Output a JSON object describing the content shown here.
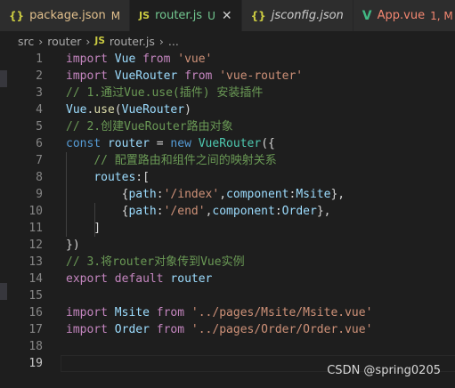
{
  "tabs": [
    {
      "icon": "{}",
      "title": "package.json",
      "badge": "M",
      "active": false
    },
    {
      "icon": "JS",
      "title": "router.js",
      "badge": "U",
      "active": true
    },
    {
      "icon": "{}",
      "title": "jsconfig.json",
      "badge": "",
      "active": false
    },
    {
      "icon": "V",
      "title": "App.vue",
      "badge": "1, M",
      "active": false
    }
  ],
  "breadcrumb": {
    "parts": [
      "src",
      "router"
    ],
    "file_icon": "JS",
    "file": "router.js",
    "ellipsis": "..."
  },
  "code_lines": [
    {
      "n": "1",
      "tokens": [
        [
          "kp",
          "import"
        ],
        [
          "p",
          " "
        ],
        [
          "v",
          "Vue"
        ],
        [
          "p",
          " "
        ],
        [
          "kp",
          "from"
        ],
        [
          "p",
          " "
        ],
        [
          "s",
          "'vue'"
        ]
      ]
    },
    {
      "n": "2",
      "tokens": [
        [
          "kp",
          "import"
        ],
        [
          "p",
          " "
        ],
        [
          "v",
          "VueRouter"
        ],
        [
          "p",
          " "
        ],
        [
          "kp",
          "from"
        ],
        [
          "p",
          " "
        ],
        [
          "s",
          "'vue-router'"
        ]
      ]
    },
    {
      "n": "3",
      "tokens": [
        [
          "c",
          "// 1.通过Vue.use(插件) 安装插件"
        ]
      ]
    },
    {
      "n": "4",
      "tokens": [
        [
          "v",
          "Vue"
        ],
        [
          "p",
          "."
        ],
        [
          "fn",
          "use"
        ],
        [
          "p",
          "("
        ],
        [
          "v",
          "VueRouter"
        ],
        [
          "p",
          ")"
        ]
      ]
    },
    {
      "n": "5",
      "tokens": [
        [
          "c",
          "// 2.创建VueRouter路由对象"
        ]
      ]
    },
    {
      "n": "6",
      "tokens": [
        [
          "k",
          "const"
        ],
        [
          "p",
          " "
        ],
        [
          "v",
          "router"
        ],
        [
          "p",
          " = "
        ],
        [
          "k",
          "new"
        ],
        [
          "p",
          " "
        ],
        [
          "cls",
          "VueRouter"
        ],
        [
          "p",
          "({"
        ]
      ]
    },
    {
      "n": "7",
      "tokens": [
        [
          "p",
          "    "
        ],
        [
          "c",
          "// 配置路由和组件之间的映射关系"
        ]
      ]
    },
    {
      "n": "8",
      "tokens": [
        [
          "p",
          "    "
        ],
        [
          "v",
          "routes"
        ],
        [
          "p",
          ":["
        ]
      ]
    },
    {
      "n": "9",
      "tokens": [
        [
          "p",
          "        {"
        ],
        [
          "v",
          "path"
        ],
        [
          "p",
          ":"
        ],
        [
          "s",
          "'/index'"
        ],
        [
          "p",
          ","
        ],
        [
          "v",
          "component"
        ],
        [
          "p",
          ":"
        ],
        [
          "v",
          "Msite"
        ],
        [
          "p",
          "},"
        ]
      ]
    },
    {
      "n": "10",
      "tokens": [
        [
          "p",
          "        {"
        ],
        [
          "v",
          "path"
        ],
        [
          "p",
          ":"
        ],
        [
          "s",
          "'/end'"
        ],
        [
          "p",
          ","
        ],
        [
          "v",
          "component"
        ],
        [
          "p",
          ":"
        ],
        [
          "v",
          "Order"
        ],
        [
          "p",
          "},"
        ]
      ]
    },
    {
      "n": "11",
      "tokens": [
        [
          "p",
          "    ]"
        ]
      ]
    },
    {
      "n": "12",
      "tokens": [
        [
          "p",
          "})"
        ]
      ]
    },
    {
      "n": "13",
      "tokens": [
        [
          "c",
          "// 3.将router对象传到Vue实例"
        ]
      ]
    },
    {
      "n": "14",
      "tokens": [
        [
          "kp",
          "export"
        ],
        [
          "p",
          " "
        ],
        [
          "kp",
          "default"
        ],
        [
          "p",
          " "
        ],
        [
          "v",
          "router"
        ]
      ]
    },
    {
      "n": "15",
      "tokens": []
    },
    {
      "n": "16",
      "tokens": [
        [
          "kp",
          "import"
        ],
        [
          "p",
          " "
        ],
        [
          "v",
          "Msite"
        ],
        [
          "p",
          " "
        ],
        [
          "kp",
          "from"
        ],
        [
          "p",
          " "
        ],
        [
          "s",
          "'../pages/Msite/Msite.vue'"
        ]
      ]
    },
    {
      "n": "17",
      "tokens": [
        [
          "kp",
          "import"
        ],
        [
          "p",
          " "
        ],
        [
          "v",
          "Order"
        ],
        [
          "p",
          " "
        ],
        [
          "kp",
          "from"
        ],
        [
          "p",
          " "
        ],
        [
          "s",
          "'../pages/Order/Order.vue'"
        ]
      ]
    },
    {
      "n": "18",
      "tokens": []
    },
    {
      "n": "19",
      "tokens": []
    }
  ],
  "current_line": "19",
  "watermark": "CSDN @spring0205"
}
